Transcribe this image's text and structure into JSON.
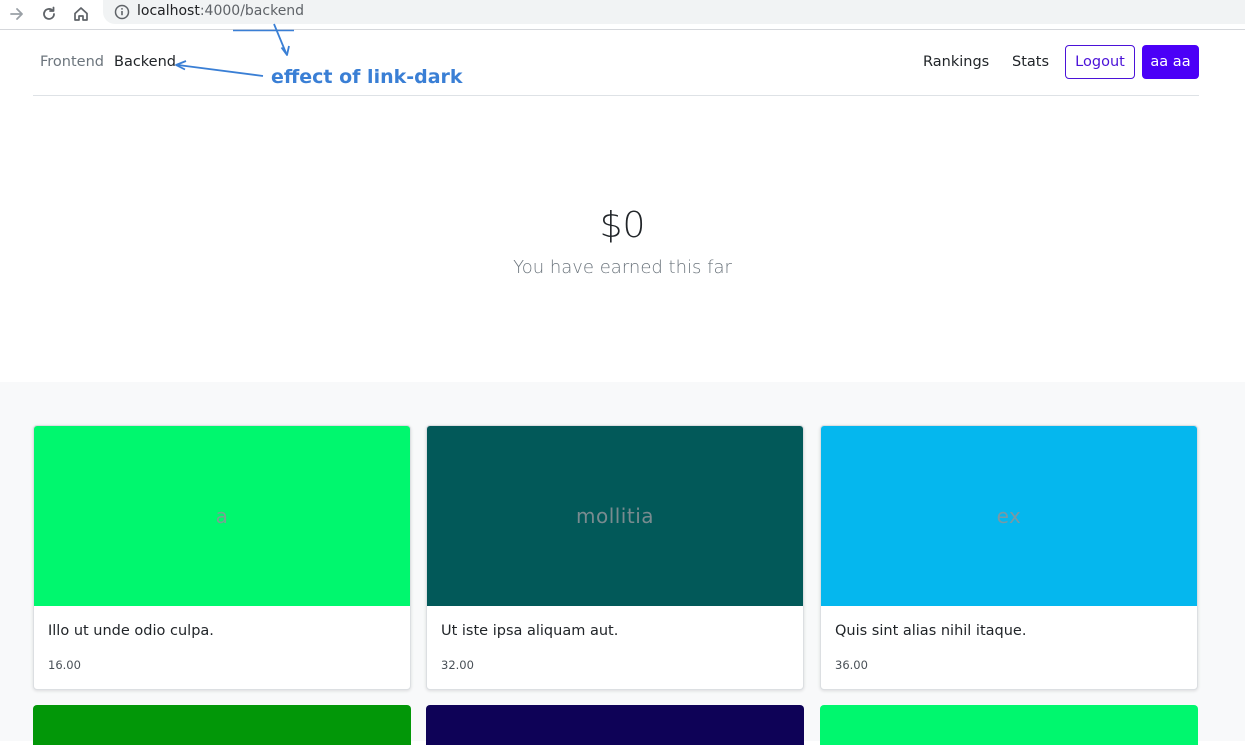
{
  "browser": {
    "url_host": "localhost",
    "url_port": ":4000",
    "url_path": "/backend"
  },
  "navbar": {
    "left_links": [
      "Frontend",
      "Backend"
    ],
    "right_links": [
      "Rankings",
      "Stats"
    ],
    "logout_label": "Logout",
    "user_label": "aa aa"
  },
  "annotation": {
    "text": "effect of link-dark",
    "color": "#3a7fd5"
  },
  "hero": {
    "amount": "$0",
    "subtitle": "You have earned this far"
  },
  "products": [
    {
      "image_text": "a",
      "color": "#00f76e",
      "title": "Illo ut unde odio culpa.",
      "price": "16.00"
    },
    {
      "image_text": "mollitia",
      "color": "#025959",
      "title": "Ut iste ipsa aliquam aut.",
      "price": "32.00"
    },
    {
      "image_text": "ex",
      "color": "#05b7ee",
      "title": "Quis sint alias nihil itaque.",
      "price": "36.00"
    }
  ],
  "products_row2_colors": [
    "#029708",
    "#0e0257",
    "#00f76e"
  ],
  "colors": {
    "primary": "#4b00f7",
    "outline": "#4b12d8",
    "muted": "#6c757d"
  }
}
